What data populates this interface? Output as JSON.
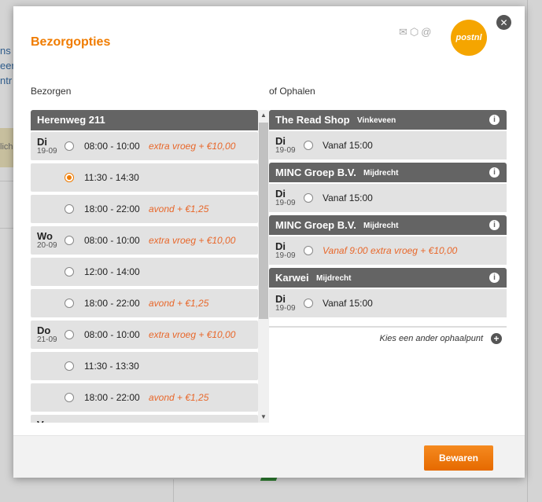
{
  "background": {
    "fragments": [
      "ns",
      "eer",
      "ntr"
    ],
    "tan_text": "lich"
  },
  "modal": {
    "title": "Bezorgopties",
    "header_icons": [
      "✉",
      "⬡",
      "@"
    ],
    "logo_text": "postnl",
    "close_label": "✕"
  },
  "delivery": {
    "label": "Bezorgen",
    "address": "Herenweg 211",
    "slots": [
      {
        "day": "Di",
        "date": "19-09",
        "time": "08:00 - 10:00",
        "extra": "extra vroeg + €10,00",
        "checked": false
      },
      {
        "day": "",
        "date": "",
        "time": "11:30 - 14:30",
        "extra": "",
        "checked": true
      },
      {
        "day": "",
        "date": "",
        "time": "18:00 - 22:00",
        "extra": "avond + €1,25",
        "checked": false
      },
      {
        "day": "Wo",
        "date": "20-09",
        "time": "08:00 - 10:00",
        "extra": "extra vroeg + €10,00",
        "checked": false
      },
      {
        "day": "",
        "date": "",
        "time": "12:00 - 14:00",
        "extra": "",
        "checked": false
      },
      {
        "day": "",
        "date": "",
        "time": "18:00 - 22:00",
        "extra": "avond + €1,25",
        "checked": false
      },
      {
        "day": "Do",
        "date": "21-09",
        "time": "08:00 - 10:00",
        "extra": "extra vroeg + €10,00",
        "checked": false
      },
      {
        "day": "",
        "date": "",
        "time": "11:30 - 13:30",
        "extra": "",
        "checked": false
      },
      {
        "day": "",
        "date": "",
        "time": "18:00 - 22:00",
        "extra": "avond + €1,25",
        "checked": false
      },
      {
        "day": "Vr",
        "date": "",
        "time": "",
        "extra": "",
        "checked": false
      }
    ]
  },
  "pickup": {
    "label": "of Ophalen",
    "locations": [
      {
        "name": "The Read Shop",
        "city": "Vinkeveen",
        "day": "Di",
        "date": "19-09",
        "time": "Vanaf 15:00",
        "orange": false
      },
      {
        "name": "MINC Groep B.V.",
        "city": "Mijdrecht",
        "day": "Di",
        "date": "19-09",
        "time": "Vanaf 15:00",
        "orange": false
      },
      {
        "name": "MINC Groep B.V.",
        "city": "Mijdrecht",
        "day": "Di",
        "date": "19-09",
        "time": "Vanaf 9:00 extra vroeg + €10,00",
        "orange": true
      },
      {
        "name": "Karwei",
        "city": "Mijdrecht",
        "day": "Di",
        "date": "19-09",
        "time": "Vanaf 15:00",
        "orange": false
      }
    ],
    "other_point_label": "Kies een ander ophaalpunt"
  },
  "footer": {
    "save_label": "Bewaren"
  }
}
